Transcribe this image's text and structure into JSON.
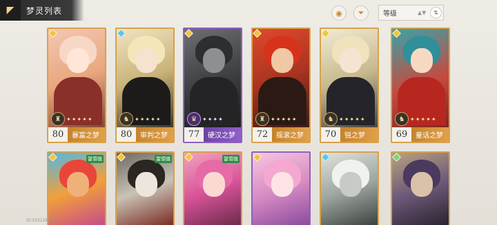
{
  "header": {
    "title": "梦灵列表"
  },
  "toolbar": {
    "sort_label": "等级",
    "sort_hint": "▲▼"
  },
  "icons": {
    "back": "back-logo-icon",
    "filter_a": "record-icon",
    "filter_b": "filter-icon",
    "order": "sort-order-icon"
  },
  "colors": {
    "gold_frame": "#d7a24a",
    "purple_frame": "#8e5fc4",
    "green_tag": "#2f8c45"
  },
  "cards_row1": [
    {
      "level": "80",
      "name": "暴富之梦",
      "stars": "✦✦✦✦✦",
      "emblem": "♜"
    },
    {
      "level": "80",
      "name": "审判之梦",
      "stars": "✦✦✦✦✦",
      "emblem": "♞"
    },
    {
      "level": "77",
      "name": "硬汉之梦",
      "stars": "✦✦✦✦",
      "emblem": "♛"
    },
    {
      "level": "72",
      "name": "摇滚之梦",
      "stars": "✦✦✦✦✦",
      "emblem": "♜"
    },
    {
      "level": "70",
      "name": "锐之梦",
      "stars": "✦✦✦✦✦",
      "emblem": "♞"
    },
    {
      "level": "69",
      "name": "童话之梦",
      "stars": "✦✦✦✦✦",
      "emblem": "♞"
    }
  ],
  "cards_row2": [
    {
      "tag": "當領值"
    },
    {
      "tag": "當領值"
    },
    {
      "tag": "當領值"
    },
    {
      "tag": ""
    },
    {
      "tag": ""
    },
    {
      "tag": ""
    }
  ],
  "footer": {
    "uid": "ID:555126942"
  }
}
